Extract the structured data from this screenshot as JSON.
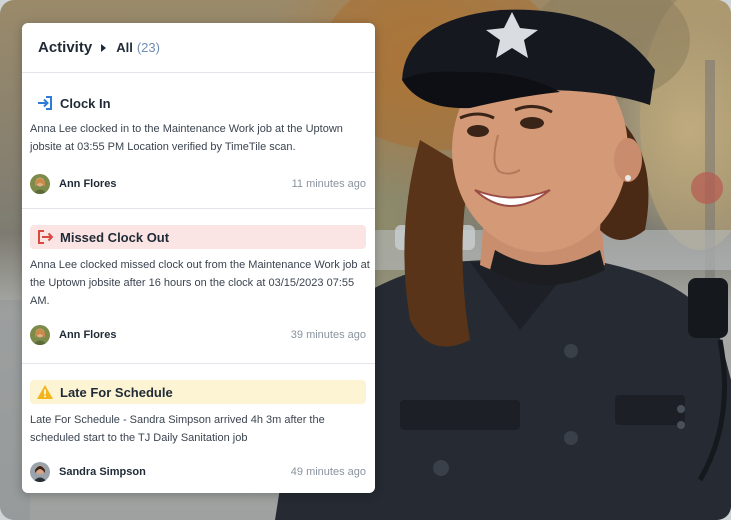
{
  "header": {
    "title": "Activity",
    "filter_label": "All",
    "filter_count": "(23)"
  },
  "items": [
    {
      "icon": "clock-in-icon",
      "title": "Clock In",
      "style": "plain",
      "body": "Anna Lee clocked in to the Maintenance Work job at the Uptown jobsite at 03:55 PM Location verified by TimeTile scan.",
      "author": "Ann Flores",
      "time": "11 minutes ago"
    },
    {
      "icon": "clock-out-icon",
      "title": "Missed Clock Out",
      "style": "red",
      "body": "Anna Lee clocked missed clock out from the Maintenance Work job at the Uptown jobsite after 16 hours on the clock at 03/15/2023 07:55 AM.",
      "author": "Ann Flores",
      "time": "39 minutes ago"
    },
    {
      "icon": "warning-icon",
      "title": "Late For Schedule",
      "style": "yellow",
      "body": "Late For Schedule - Sandra Simpson arrived 4h 3m after the scheduled start to the TJ Daily Sanitation job",
      "author": "Sandra Simpson",
      "time": "49 minutes ago"
    }
  ],
  "colors": {
    "clock_in_blue": "#2f7bd6",
    "clock_out_red": "#d9493f",
    "warning_yellow": "#f2b51c"
  }
}
